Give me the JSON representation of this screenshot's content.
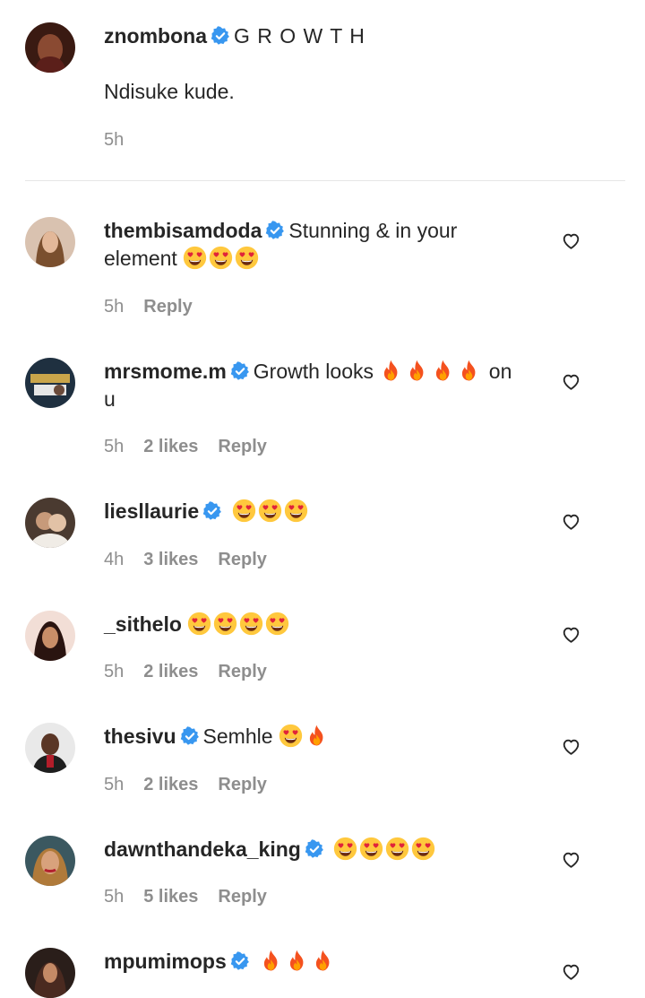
{
  "caption": {
    "username": "znombona",
    "headline": "G R O W T H",
    "text": "Ndisuke kude.",
    "time": "5h"
  },
  "comments": [
    {
      "username": "thembisamdoda",
      "text_before": "Stunning & in your",
      "text_line2": "element",
      "emoji": [
        "heart-eyes",
        "heart-eyes",
        "heart-eyes"
      ],
      "time": "5h",
      "likes": "",
      "reply": "Reply"
    },
    {
      "username": "mrsmome.m",
      "text_before": "Growth looks",
      "emoji": [
        "fire",
        "fire",
        "fire",
        "fire"
      ],
      "text_after": "on",
      "text_line2": "u",
      "time": "5h",
      "likes": "2 likes",
      "reply": "Reply"
    },
    {
      "username": "liesllaurie",
      "emoji": [
        "heart-eyes",
        "heart-eyes",
        "heart-eyes"
      ],
      "time": "4h",
      "likes": "3 likes",
      "reply": "Reply"
    },
    {
      "username": "_sithelo",
      "emoji": [
        "heart-eyes",
        "heart-eyes",
        "heart-eyes",
        "heart-eyes"
      ],
      "time": "5h",
      "likes": "2 likes",
      "reply": "Reply"
    },
    {
      "username": "thesivu",
      "text_before": "Semhle",
      "emoji": [
        "heart-eyes",
        "fire"
      ],
      "time": "5h",
      "likes": "2 likes",
      "reply": "Reply"
    },
    {
      "username": "dawnthandeka_king",
      "emoji": [
        "heart-eyes",
        "heart-eyes",
        "heart-eyes",
        "heart-eyes"
      ],
      "time": "5h",
      "likes": "5 likes",
      "reply": "Reply"
    },
    {
      "username": "mpumimops",
      "emoji": [
        "fire",
        "fire",
        "fire"
      ],
      "time": "",
      "likes": "",
      "reply": ""
    }
  ],
  "colors": {
    "verified": "#3897f0",
    "meta": "#8e8e8e",
    "text": "#262626"
  },
  "icons": {
    "verified": "verified-badge-icon",
    "like": "heart-outline-icon"
  }
}
